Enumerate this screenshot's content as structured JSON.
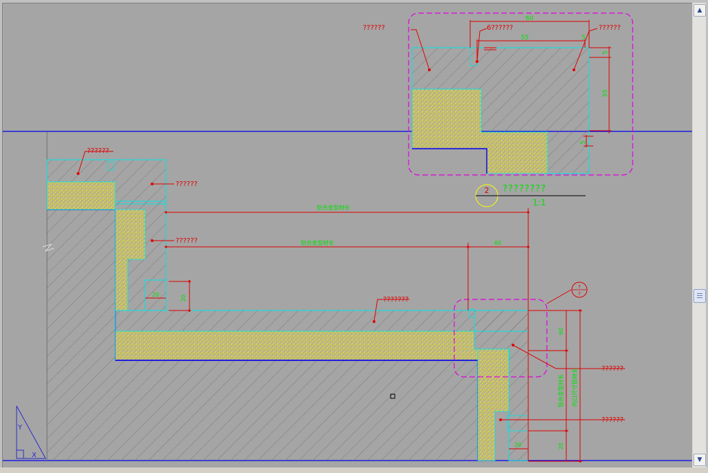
{
  "window": {
    "background_color": "#a5a5a5"
  },
  "detail_labels": {
    "top_left_label": "??????",
    "label_a": "??????",
    "label_b": "??????",
    "label_c": "??????",
    "label_d": "???????",
    "label_e": "??????",
    "label_f": "??????",
    "inset_left": "??????",
    "inset_mid": "6??????",
    "inset_right": "??????"
  },
  "inset_title": {
    "number": "2",
    "name": "????????",
    "scale": "1:1"
  },
  "section_marker": {
    "top": "?",
    "bottom": "?"
  },
  "dimensions": {
    "inset_overall": "60",
    "inset_inner": "55",
    "inset_small": "5",
    "inset_right_a": "5",
    "inset_right_b": "35",
    "inset_bottom": "5",
    "long_top": "铝合金型材长",
    "long_mid": "铝合金型材长",
    "long_right": "60",
    "small_a": "20",
    "small_b": "20",
    "right_vert_a": "60",
    "right_vert_b": "铝合金型材长",
    "right_vert_c": "内口尺寸铝材长",
    "right_vert_d": "20",
    "bottom_small": "20"
  },
  "colors": {
    "red": "#e00000",
    "green": "#00e000",
    "cyan": "#00e5e5",
    "magenta": "#e000e0",
    "blue": "#0000ee",
    "yellow": "#ffff00"
  },
  "scrollbar": {
    "up_icon": "▲",
    "down_icon": "▼"
  }
}
